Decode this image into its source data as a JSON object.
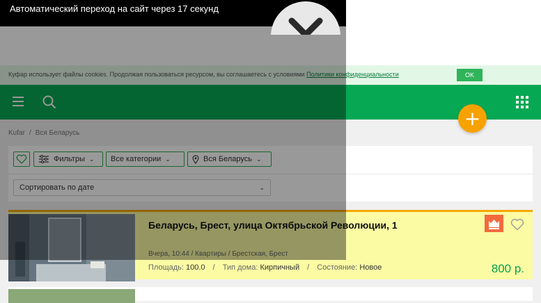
{
  "overlay": {
    "redirect_text": "Автоматический переход на сайт через 17 секунд"
  },
  "cookie_bar": {
    "text": "Куфар использует файлы cookies. Продолжая пользоваться ресурсом, вы соглашаетесь с условиями ",
    "link": "Политики конфиденциальности",
    "ok_label": "OK"
  },
  "header": {
    "add_label": "+"
  },
  "breadcrumb": {
    "home": "Kufar",
    "separator": "/",
    "current": "Вся Беларусь"
  },
  "filters": {
    "filters_label": "Фильтры",
    "categories_label": "Все категории",
    "region_label": "Вся Беларусь",
    "sort_label": "Сортировать по дате"
  },
  "listing": {
    "title": "Беларусь, Брест, улица Октябрьской Революции, 1",
    "meta": "Вчера, 10:44 / Квартиры / Брестская, Брест",
    "area_label": "Площадь:",
    "area_value": "100.0",
    "house_label": "Тип дома:",
    "house_value": "Кирпичный",
    "state_label": "Состояние:",
    "state_value": "Новое",
    "price": "800 р.",
    "slash": "/"
  },
  "colors": {
    "brand_green": "#07a854",
    "highlight_yellow": "#fbfba4",
    "accent_orange": "#f6a200",
    "price_green": "#08a34f"
  },
  "icons": [
    "menu-icon",
    "search-icon",
    "grid-icon",
    "plus-icon",
    "heart-icon",
    "sliders-icon",
    "location-pin-icon",
    "chevron-down-icon",
    "close-icon",
    "promo-badge-icon"
  ]
}
